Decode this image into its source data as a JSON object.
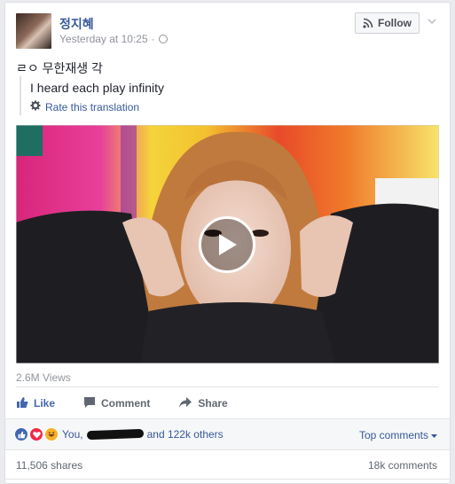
{
  "post": {
    "author": "정지혜",
    "timestamp": "Yesterday at 10:25",
    "separator": "·",
    "follow_label": "Follow",
    "text": "ㄹㅇ 무한재생 각",
    "translation": "I heard each play infinity",
    "rate_translation": "Rate this translation"
  },
  "video": {
    "views": "2.6M Views"
  },
  "actions": {
    "like": "Like",
    "comment": "Comment",
    "share": "Share"
  },
  "reactions": {
    "prefix": "You,",
    "suffix": "and 122k others",
    "top_comments": "Top comments"
  },
  "counts": {
    "shares": "11,506 shares",
    "comments": "18k comments"
  },
  "colors": {
    "link": "#365899",
    "like_blue": "#4267b2",
    "love_red": "#f0284a"
  },
  "icons": [
    "globe-icon",
    "rss-icon",
    "chevron-down-icon",
    "gear-icon",
    "play-icon",
    "like-icon",
    "comment-icon",
    "share-icon",
    "like-reaction-icon",
    "love-reaction-icon",
    "haha-reaction-icon",
    "caret-down-icon"
  ]
}
